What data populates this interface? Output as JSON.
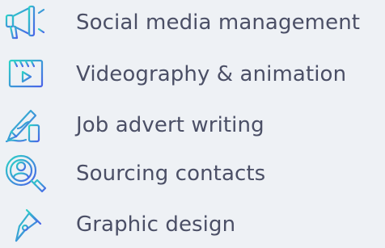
{
  "colors": {
    "background": "#eef1f5",
    "text": "#4b4f66",
    "icon_gradient_start": "#2cd3c6",
    "icon_gradient_end": "#4a63e8"
  },
  "services": [
    {
      "label": "Social media management",
      "icon": "megaphone-icon"
    },
    {
      "label": "Videography & animation",
      "icon": "video-player-icon"
    },
    {
      "label": "Job advert writing",
      "icon": "pen-writing-icon"
    },
    {
      "label": "Sourcing contacts",
      "icon": "user-search-icon"
    },
    {
      "label": "Graphic design",
      "icon": "pen-nib-icon"
    }
  ]
}
